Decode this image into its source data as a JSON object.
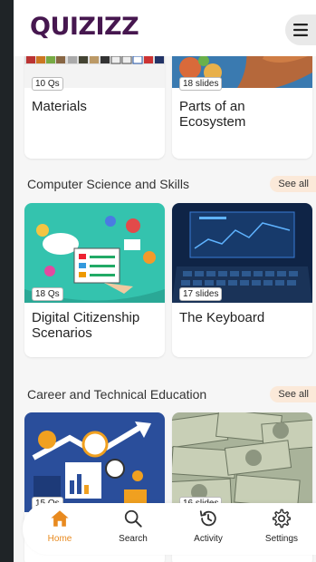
{
  "app": {
    "logo": "QUIZIZZ"
  },
  "top_cards": [
    {
      "badge": "10 Qs",
      "title": "Materials"
    },
    {
      "badge": "18 slides",
      "title": "Parts of an Ecosystem"
    }
  ],
  "sections": [
    {
      "title": "Computer Science and Skills",
      "see_all": "See all",
      "cards": [
        {
          "badge": "18 Qs",
          "title": "Digital Citizenship Scenarios"
        },
        {
          "badge": "17 slides",
          "title": "The Keyboard"
        }
      ]
    },
    {
      "title": "Career and Technical Education",
      "see_all": "See all",
      "cards": [
        {
          "badge": "15 Qs"
        },
        {
          "badge": "16 slides"
        }
      ]
    }
  ],
  "bottom_nav": [
    {
      "label": "Home",
      "icon": "home-icon",
      "active": true
    },
    {
      "label": "Search",
      "icon": "search-icon"
    },
    {
      "label": "Activity",
      "icon": "history-icon"
    },
    {
      "label": "Settings",
      "icon": "gear-icon"
    }
  ],
  "colors": {
    "brand": "#46174f",
    "accent": "#e88a1f",
    "see_all_bg": "#fbe9d9"
  }
}
